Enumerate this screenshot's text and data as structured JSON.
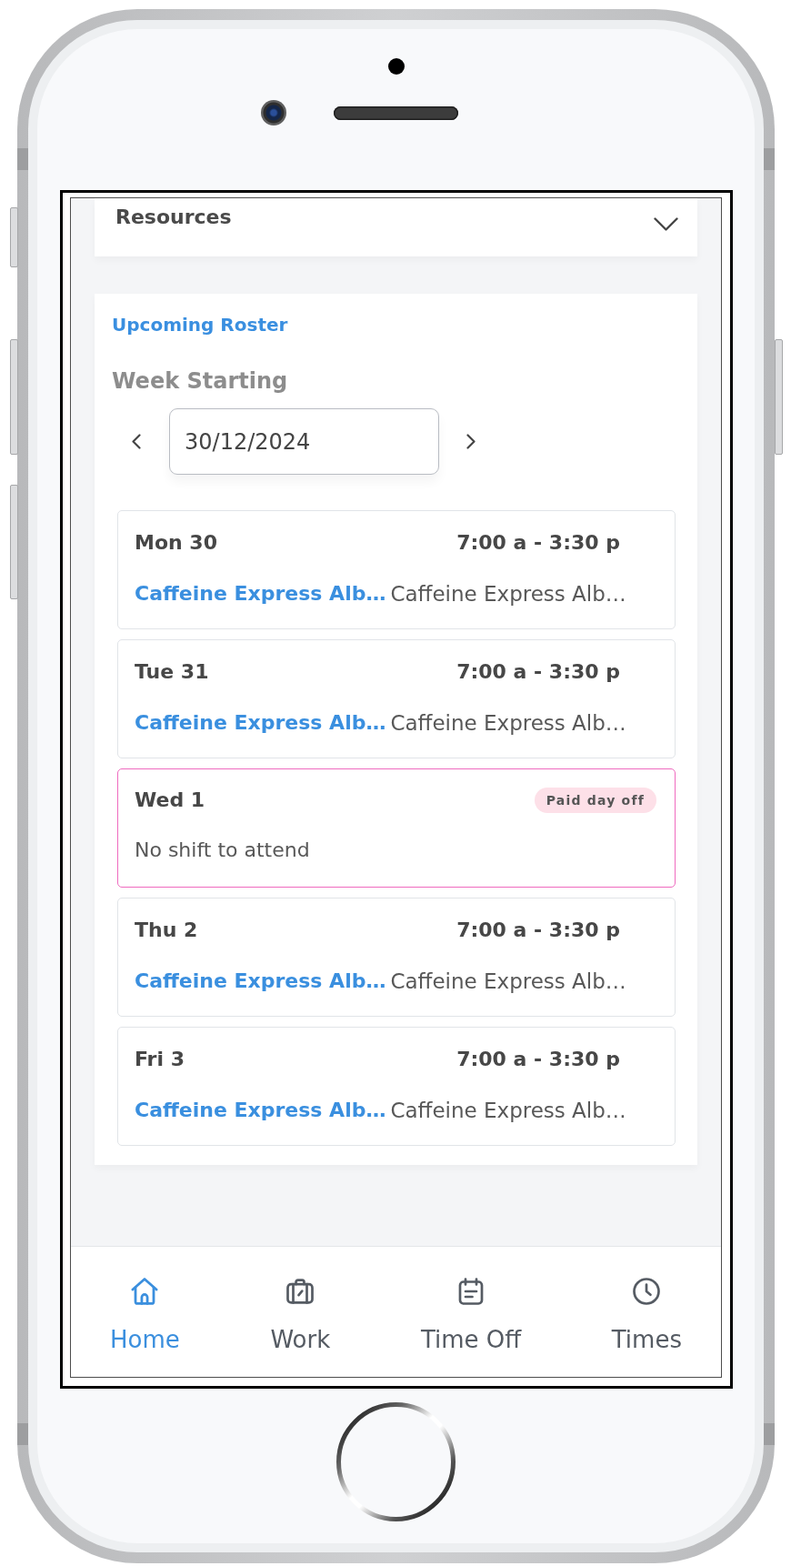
{
  "resources": {
    "title": "Resources",
    "expanded": false
  },
  "roster": {
    "title": "Upcoming Roster",
    "week_label": "Week Starting",
    "week_start": "30/12/2024",
    "shifts": [
      {
        "kind": "shift",
        "day": "Mon 30",
        "time": "7:00 a - 3:30 p",
        "location": "Caffeine Express Alb…",
        "location_detail": "Caffeine Express Alb…"
      },
      {
        "kind": "shift",
        "day": "Tue 31",
        "time": "7:00 a - 3:30 p",
        "location": "Caffeine Express Alb…",
        "location_detail": "Caffeine Express Alb…"
      },
      {
        "kind": "leave",
        "day": "Wed 1",
        "badge": "Paid day off",
        "note": "No shift to attend"
      },
      {
        "kind": "shift",
        "day": "Thu 2",
        "time": "7:00 a - 3:30 p",
        "location": "Caffeine Express Alb…",
        "location_detail": "Caffeine Express Alb…"
      },
      {
        "kind": "shift",
        "day": "Fri 3",
        "time": "7:00 a - 3:30 p",
        "location": "Caffeine Express Alb…",
        "location_detail": "Caffeine Express Alb…"
      }
    ]
  },
  "nav": [
    {
      "label": "Home",
      "selected": true
    },
    {
      "label": "Work",
      "selected": false
    },
    {
      "label": "Time Off",
      "selected": false
    },
    {
      "label": "Times",
      "selected": false
    }
  ]
}
